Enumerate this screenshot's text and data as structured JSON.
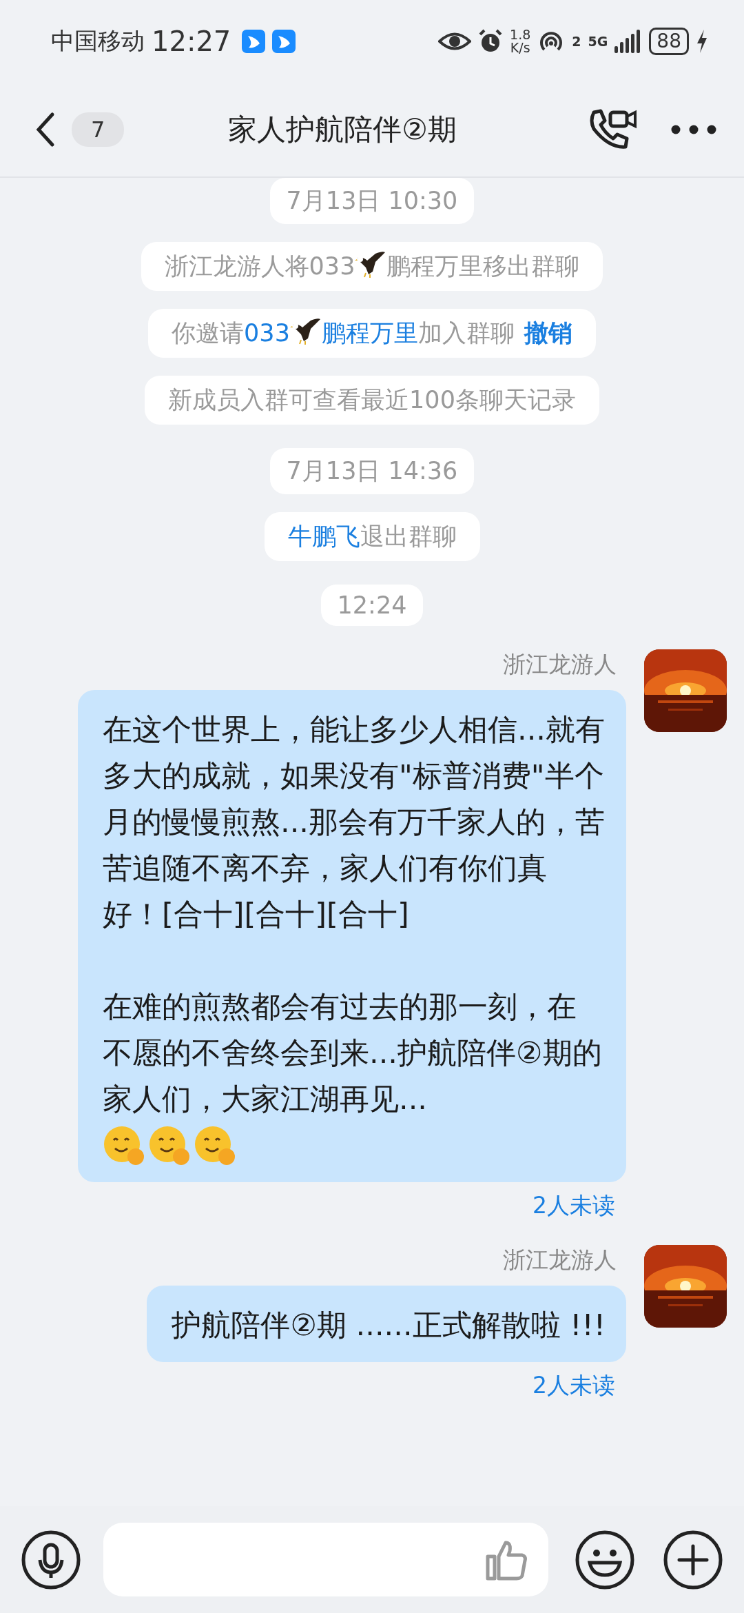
{
  "status_bar": {
    "carrier": "中国移动",
    "time": "12:27",
    "net_speed": "1.8",
    "net_speed_unit": "K/s",
    "hotspot_count": "2",
    "network": "5G",
    "battery": "88"
  },
  "header": {
    "back_count": "7",
    "title": "家人护航陪伴②期"
  },
  "feed": [
    {
      "kind": "time",
      "text": "7月13日 10:30"
    },
    {
      "kind": "notice",
      "segments": [
        {
          "kind": "text",
          "text": "浙江龙游人将033"
        },
        {
          "kind": "eagle"
        },
        {
          "kind": "text",
          "text": "鹏程万里移出群聊"
        }
      ]
    },
    {
      "kind": "notice",
      "segments": [
        {
          "kind": "text",
          "text": "你邀请"
        },
        {
          "kind": "link",
          "text": "033"
        },
        {
          "kind": "eagle"
        },
        {
          "kind": "link",
          "text": "鹏程万里"
        },
        {
          "kind": "text",
          "text": "加入群聊"
        },
        {
          "kind": "action",
          "text": "撤销"
        }
      ]
    },
    {
      "kind": "notice",
      "segments": [
        {
          "kind": "text",
          "text": "新成员入群可查看最近100条聊天记录"
        }
      ]
    },
    {
      "kind": "time",
      "text": "7月13日 14:36"
    },
    {
      "kind": "notice",
      "segments": [
        {
          "kind": "link",
          "text": "牛鹏飞"
        },
        {
          "kind": "text",
          "text": "退出群聊"
        }
      ]
    },
    {
      "kind": "time",
      "text": "12:24"
    },
    {
      "kind": "message",
      "sender": "浙江龙游人",
      "paragraphs": [
        "在这个世界上，能让多少人相信...就有多大的成就，如果没有\"标普消费\"半个月的慢慢煎熬...那会有万千家人的，苦苦追随不离不弃，家人们有你们真好！[合十][合十][合十]",
        "在难的煎熬都会有过去的那一刻，在不愿的不舍终会到来...护航陪伴②期的家人们，大家江湖再见..."
      ],
      "emojis": [
        {
          "kind": "face"
        },
        {
          "kind": "face"
        },
        {
          "kind": "face"
        }
      ],
      "receipt": "2人未读"
    },
    {
      "kind": "message",
      "sender": "浙江龙游人",
      "paragraphs": [
        "护航陪伴②期 ......正式解散啦 !!!"
      ],
      "receipt": "2人未读"
    }
  ]
}
